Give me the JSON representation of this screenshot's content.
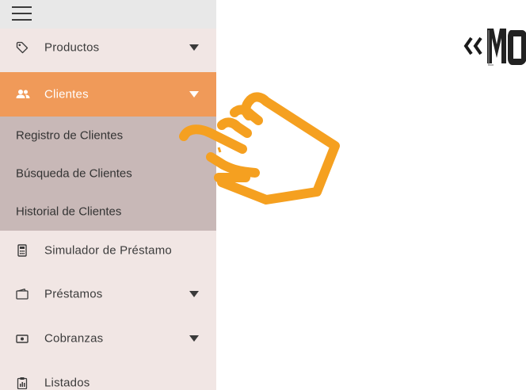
{
  "sidebar": {
    "items": [
      {
        "label": "Productos",
        "icon": "tag-icon",
        "has_caret": true
      },
      {
        "label": "Clientes",
        "icon": "users-icon",
        "has_caret": true,
        "active": true
      },
      {
        "label": "Simulador de Préstamo",
        "icon": "calculator-icon",
        "has_caret": false
      },
      {
        "label": "Préstamos",
        "icon": "wallet-icon",
        "has_caret": true
      },
      {
        "label": "Cobranzas",
        "icon": "money-icon",
        "has_caret": true
      },
      {
        "label": "Listados",
        "icon": "clipboard-icon",
        "has_caret": false
      }
    ],
    "submenu": [
      {
        "label": "Registro de Clientes"
      },
      {
        "label": "Búsqueda de Clientes"
      },
      {
        "label": "Historial de Clientes"
      }
    ]
  },
  "colors": {
    "sidebar_bg": "#f1e6e4",
    "active_bg": "#f09a59",
    "submenu_bg": "#c8b8b7",
    "hand_pointer": "#f5a020"
  },
  "overlay": {
    "icon": "pointing-hand-icon"
  }
}
